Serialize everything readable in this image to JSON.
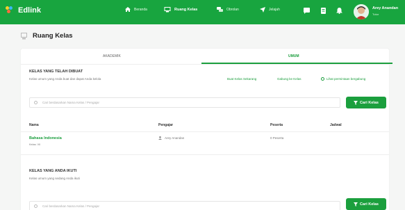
{
  "header": {
    "logo_text": "Edlink",
    "nav": [
      {
        "label": "Beranda",
        "icon": "home-icon"
      },
      {
        "label": "Ruang Kelas",
        "icon": "classroom-icon"
      },
      {
        "label": "Obrolan",
        "icon": "chat-icon"
      },
      {
        "label": "Jelajah",
        "icon": "explore-icon"
      }
    ],
    "user_name": "Arey Anandan",
    "user_role": "Tutor",
    "accent": "#18a53f"
  },
  "page": {
    "title": "Ruang Kelas"
  },
  "tabs": [
    {
      "label": "AKADEMIK",
      "active": false
    },
    {
      "label": "UMUM",
      "active": true
    }
  ],
  "created": {
    "title": "KELAS YANG TELAH DIBUAT",
    "subtitle": "Kelas umum yang Anda buat dan dapat Anda kelola",
    "links": {
      "create": "Buat Kelas Sekarang",
      "join": "Gabung ke Kelas",
      "requests": "Lihat permintaan bergabung"
    },
    "search_placeholder": "Cari berdasarkan Nama Kelas / Pengajar",
    "search_button": "Cari Kelas"
  },
  "table": {
    "headers": [
      "Nama",
      "Pengajar",
      "Peserta",
      "Jadwal"
    ],
    "rows": [
      {
        "name": "Bahasa Indonesia",
        "class": "Kelas: VII",
        "teacher": "Arey Anandan",
        "participants": "0 Peserta",
        "schedule": ""
      }
    ]
  },
  "joined": {
    "title": "KELAS YANG ANDA IKUTI",
    "subtitle": "Kelas umum yang sedang Anda ikuti",
    "search_placeholder": "Cari berdasarkan Nama Kelas / Pengajar",
    "search_button": "Cari Kelas"
  }
}
